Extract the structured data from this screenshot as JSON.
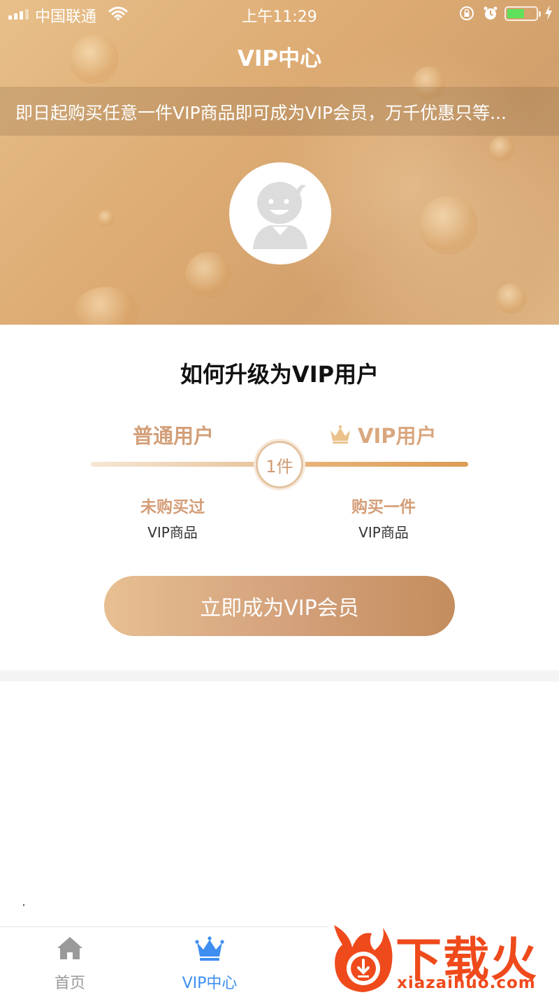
{
  "status_bar": {
    "carrier": "中国联通",
    "time": "上午11:29",
    "battery_level_percent": 60,
    "icons": [
      "signal-icon",
      "wifi-icon",
      "orientation-lock-icon",
      "alarm-icon",
      "battery-icon",
      "charging-icon"
    ]
  },
  "header": {
    "title": "VIP中心"
  },
  "notice": {
    "text": "即日起购买任意一件VIP商品即可成为VIP会员，万千优惠只等..."
  },
  "upgrade": {
    "title": "如何升级为VIP用户",
    "normal_level": "普通用户",
    "vip_level": "VIP用户",
    "threshold": "1件",
    "normal_condition_line1": "未购买过",
    "normal_condition_line2": "VIP商品",
    "vip_condition_line1": "购买一件",
    "vip_condition_line2": "VIP商品",
    "cta_label": "立即成为VIP会员"
  },
  "tabbar": {
    "home_label": "首页",
    "vip_label": "VIP中心",
    "active_tab": "VIP中心",
    "active_color": "#3d8ef0",
    "inactive_color": "#9a9a9a"
  },
  "watermark": {
    "brand": "下载火",
    "url": "xiazaihuo.com"
  },
  "colors": {
    "accent_gold": "#d3a07a",
    "hero_gradient": "#dcaa72"
  }
}
